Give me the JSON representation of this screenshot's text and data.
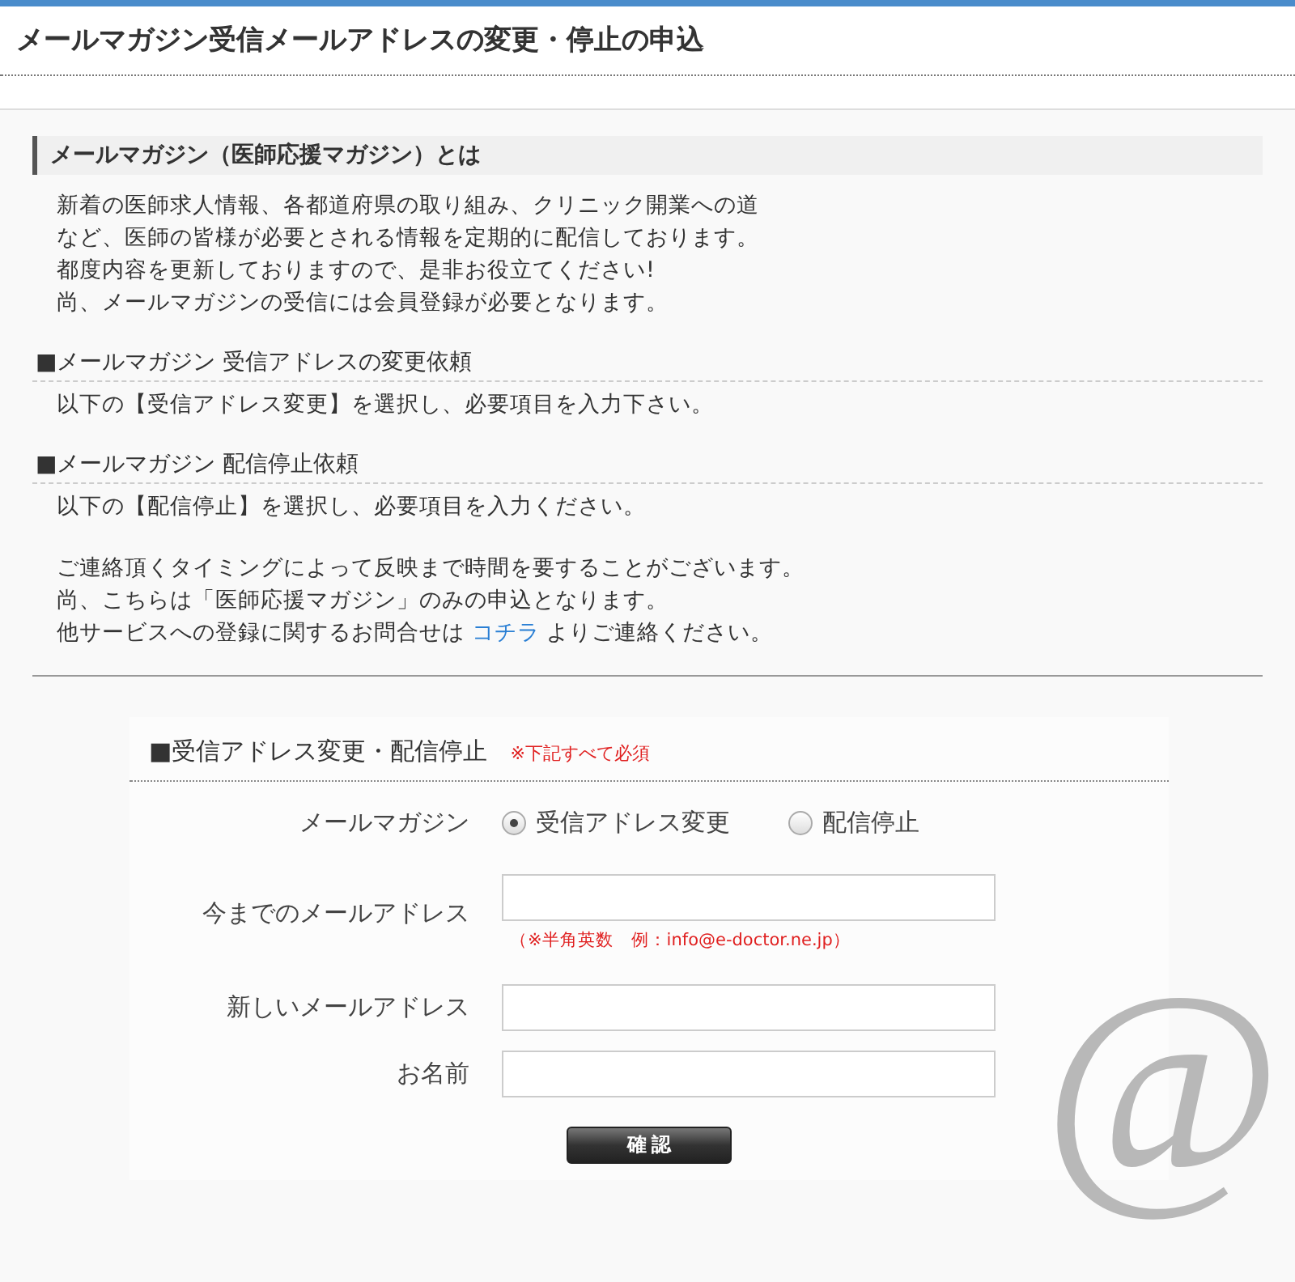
{
  "page_title": "メールマガジン受信メールアドレスの変更・停止の申込",
  "intro": {
    "heading": "メールマガジン（医師応援マガジン）とは",
    "lines": [
      "新着の医師求人情報、各都道府県の取り組み、クリニック開業への道",
      "など、医師の皆様が必要とされる情報を定期的に配信しております。",
      "都度内容を更新しておりますので、是非お役立てください!",
      "尚、メールマガジンの受信には会員登録が必要となります。"
    ]
  },
  "sections": [
    {
      "heading": "■メールマガジン 受信アドレスの変更依頼",
      "text": "以下の【受信アドレス変更】を選択し、必要項目を入力下さい。"
    },
    {
      "heading": "■メールマガジン 配信停止依頼",
      "text": "以下の【配信停止】を選択し、必要項目を入力ください。"
    }
  ],
  "notes": [
    "ご連絡頂くタイミングによって反映まで時間を要することがございます。",
    "尚、こちらは「医師応援マガジン」のみの申込となります。"
  ],
  "contact": {
    "before": "他サービスへの登録に関するお問合せは ",
    "link": "コチラ",
    "after": " よりご連絡ください。"
  },
  "form": {
    "title": "■受信アドレス変更・配信停止",
    "required_note": "※下記すべて必須",
    "rows": [
      {
        "kind": "radio",
        "label": "メールマガジン",
        "options": [
          {
            "label": "受信アドレス変更",
            "selected": true
          },
          {
            "label": "配信停止",
            "selected": false
          }
        ]
      },
      {
        "kind": "input",
        "label": "今までのメールアドレス",
        "hint": "（※半角英数　例：info@e-doctor.ne.jp）"
      },
      {
        "kind": "input",
        "label": "新しいメールアドレス"
      },
      {
        "kind": "input",
        "label": "お名前"
      }
    ],
    "submit": "確 認"
  },
  "background_mark": "@"
}
